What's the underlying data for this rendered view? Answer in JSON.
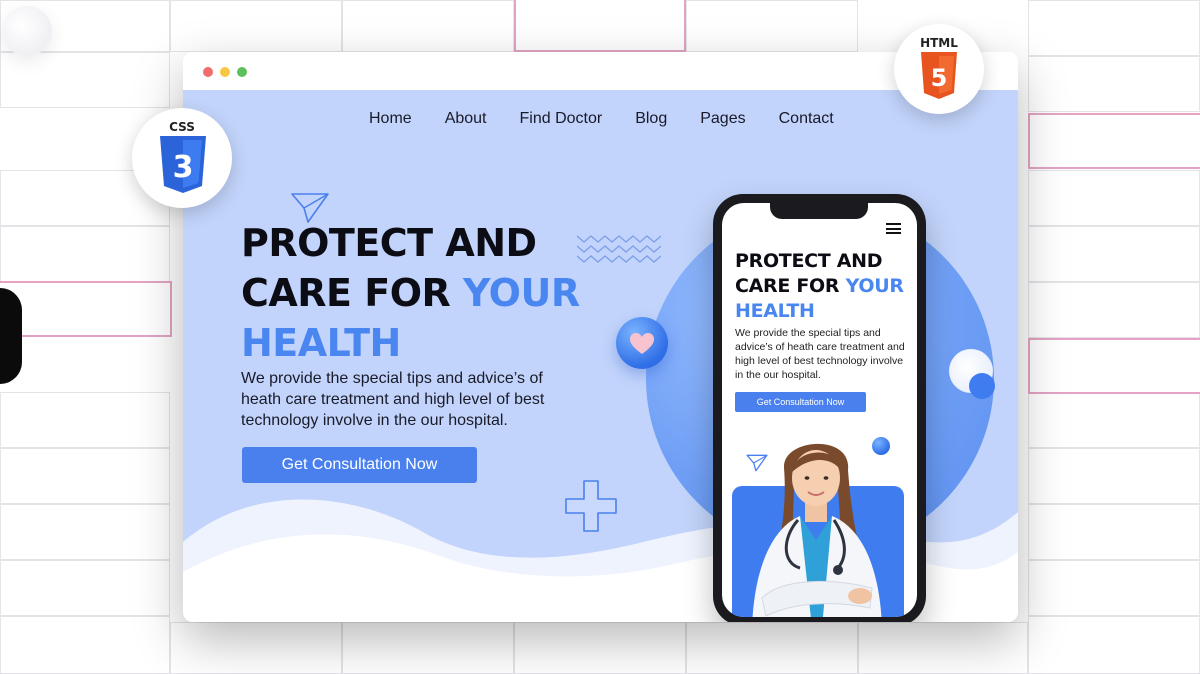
{
  "nav": {
    "items": [
      {
        "label": "Home"
      },
      {
        "label": "About"
      },
      {
        "label": "Find Doctor"
      },
      {
        "label": "Blog"
      },
      {
        "label": "Pages"
      },
      {
        "label": "Contact"
      }
    ]
  },
  "hero": {
    "headline_line1": "PROTECT AND",
    "headline_line2": "CARE FOR ",
    "headline_accent1": "YOUR",
    "headline_accent2": "HEALTH",
    "subtext": "We provide the special tips and advice’s of heath care treatment and high level of best technology involve in the our hospital.",
    "cta_label": "Get Consultation Now"
  },
  "mobile": {
    "headline_line1": "PROTECT AND",
    "headline_line2": "CARE FOR ",
    "headline_accent1": "YOUR",
    "headline_accent2": "HEALTH",
    "subtext": "We provide the special tips and advice’s of heath care treatment and high level of best technology involve in the our hospital.",
    "cta_label": "Get Consultation Now",
    "menu_icon": "hamburger-icon"
  },
  "badges": {
    "css_label": "CSS",
    "css_number": "3",
    "html_label": "HTML",
    "html_number": "5"
  },
  "colors": {
    "accent": "#4a86f0",
    "hero_background": "#c2d4fb",
    "button": "#4a80ee",
    "css_shield": "#2b63d8",
    "html_shield": "#e8541f"
  },
  "icons": [
    "paper-plane-icon",
    "zigzag-pattern-icon",
    "plus-cross-icon",
    "heart-icon",
    "css3-logo-icon",
    "html5-logo-icon"
  ]
}
